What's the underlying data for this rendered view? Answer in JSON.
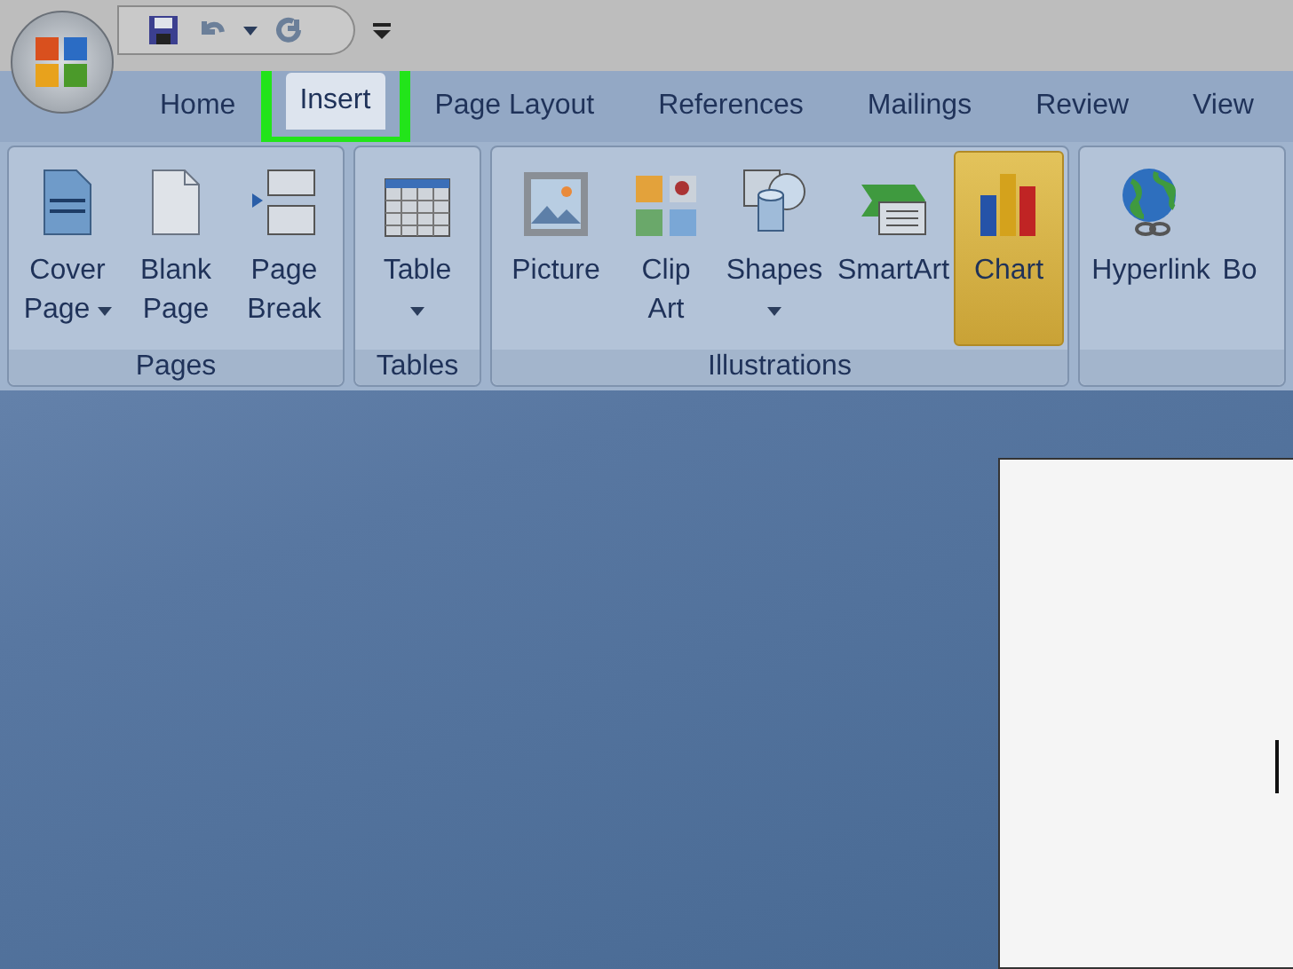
{
  "tabs": [
    {
      "label": "Home",
      "selected": false,
      "annotated": false
    },
    {
      "label": "Insert",
      "selected": true,
      "annotated": true
    },
    {
      "label": "Page Layout",
      "selected": false,
      "annotated": false
    },
    {
      "label": "References",
      "selected": false,
      "annotated": false
    },
    {
      "label": "Mailings",
      "selected": false,
      "annotated": false
    },
    {
      "label": "Review",
      "selected": false,
      "annotated": false
    },
    {
      "label": "View",
      "selected": false,
      "annotated": false
    }
  ],
  "ribbon_groups": [
    {
      "label": "Pages",
      "buttons": [
        {
          "kind": "cover",
          "lines": [
            "Cover",
            "Page"
          ],
          "dropdown": true,
          "highlighted": false
        },
        {
          "kind": "blank",
          "lines": [
            "Blank",
            "Page"
          ],
          "dropdown": false,
          "highlighted": false
        },
        {
          "kind": "pagebreak",
          "lines": [
            "Page",
            "Break"
          ],
          "dropdown": false,
          "highlighted": false
        }
      ]
    },
    {
      "label": "Tables",
      "buttons": [
        {
          "kind": "table",
          "lines": [
            "Table"
          ],
          "dropdown": true,
          "highlighted": false
        }
      ]
    },
    {
      "label": "Illustrations",
      "buttons": [
        {
          "kind": "picture",
          "lines": [
            "Picture"
          ],
          "dropdown": false,
          "highlighted": false
        },
        {
          "kind": "clipart",
          "lines": [
            "Clip",
            "Art"
          ],
          "dropdown": false,
          "highlighted": false
        },
        {
          "kind": "shapes",
          "lines": [
            "Shapes"
          ],
          "dropdown": true,
          "highlighted": false
        },
        {
          "kind": "smartart",
          "lines": [
            "SmartArt"
          ],
          "dropdown": false,
          "highlighted": false
        },
        {
          "kind": "chart",
          "lines": [
            "Chart"
          ],
          "dropdown": false,
          "highlighted": true
        }
      ]
    },
    {
      "buttons": [
        {
          "kind": "hyperlink",
          "lines": [
            "Hyperlink"
          ],
          "dropdown": false,
          "highlighted": false
        },
        {
          "kind": "textonly",
          "lines": [
            "Bo"
          ],
          "dropdown": false,
          "highlighted": false
        }
      ]
    }
  ]
}
